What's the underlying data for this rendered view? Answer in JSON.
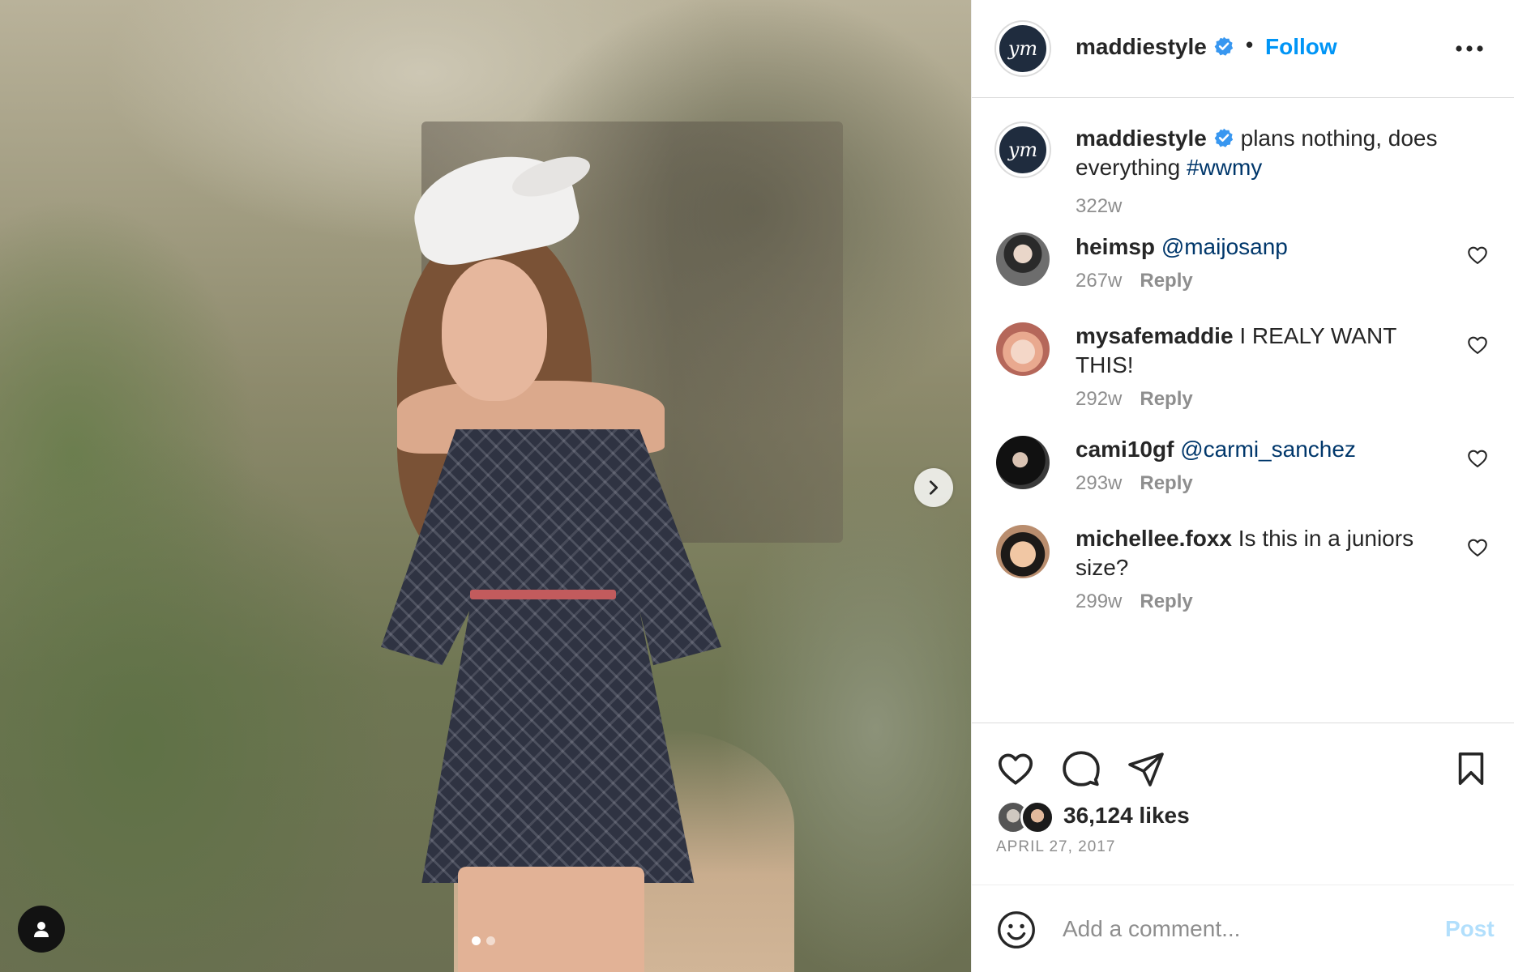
{
  "post": {
    "username": "maddiestyle",
    "separator": "•",
    "follow_label": "Follow",
    "avatar_monogram": "ym",
    "caption_text": "plans nothing, does everything",
    "caption_hashtag": "#wwmy",
    "caption_time": "322w"
  },
  "media": {
    "carousel_dots": 2,
    "active_dot": 1
  },
  "comments": [
    {
      "username": "heimsp",
      "text": "",
      "mention": "@maijosanp",
      "time": "267w",
      "reply_label": "Reply"
    },
    {
      "username": "mysafemaddie",
      "text": "I REALY WANT THIS!",
      "mention": "",
      "time": "292w",
      "reply_label": "Reply"
    },
    {
      "username": "cami10gf",
      "text": "",
      "mention": "@carmi_sanchez",
      "time": "293w",
      "reply_label": "Reply"
    },
    {
      "username": "michellee.foxx",
      "text": "Is this in a juniors size?",
      "mention": "",
      "time": "299w",
      "reply_label": "Reply"
    }
  ],
  "engagement": {
    "likes": "36,124 likes",
    "date": "APRIL 27, 2017"
  },
  "composer": {
    "placeholder": "Add a comment...",
    "post_label": "Post"
  },
  "colors": {
    "accent": "#0095f6",
    "link": "#00376b",
    "secondary_text": "#8e8e8e",
    "post_disabled": "#b2dffc",
    "verified_badge": "#3897f0"
  }
}
